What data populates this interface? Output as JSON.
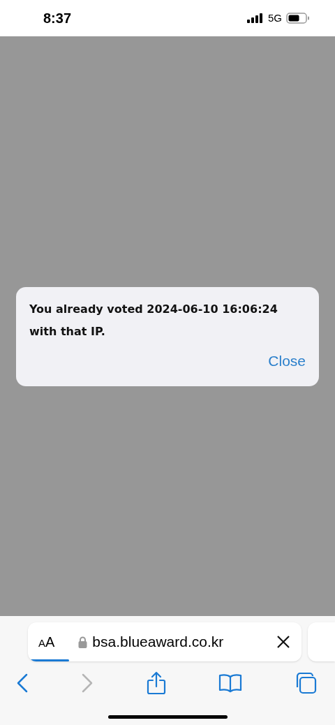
{
  "status_bar": {
    "time": "8:37",
    "network": "5G"
  },
  "alert": {
    "message": "You already voted 2024-06-10 16:06:24 with that IP.",
    "button": "Close"
  },
  "address_bar": {
    "reader_button": "AA",
    "url": "bsa.blueaward.co.kr",
    "level": 0.15
  },
  "toolbar": {
    "back_disabled": false,
    "forward_disabled": true
  }
}
